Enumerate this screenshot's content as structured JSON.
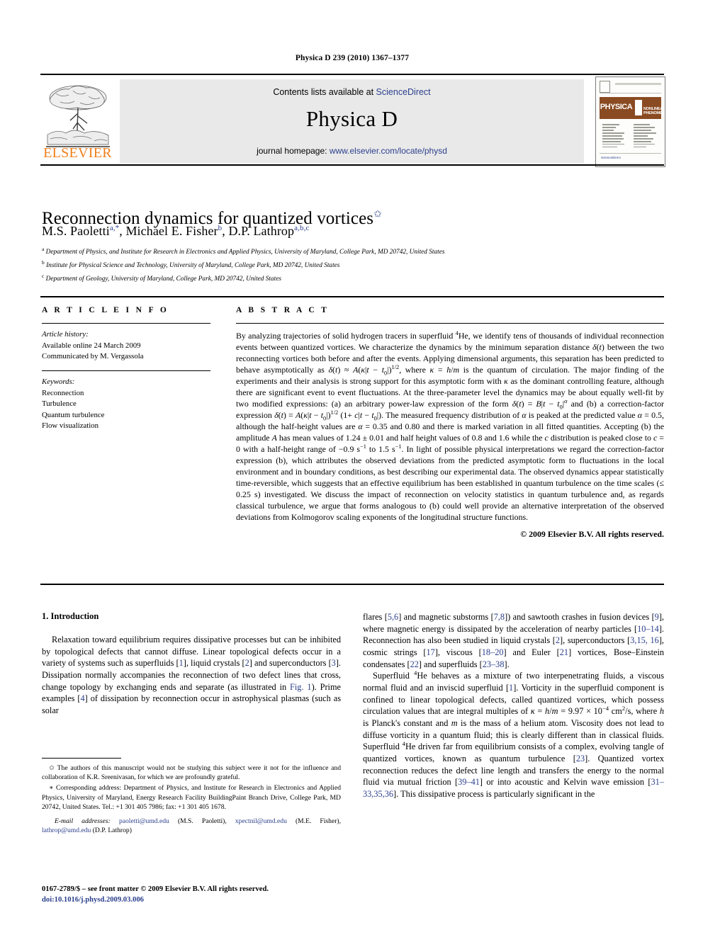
{
  "running_head": "Physica D 239 (2010) 1367–1377",
  "masthead": {
    "contents_prefix": "Contents lists available at ",
    "sciencedirect": "ScienceDirect",
    "journal_title": "Physica D",
    "homepage_prefix": "journal homepage: ",
    "homepage_url": "www.elsevier.com/locate/physd",
    "publisher": "ELSEVIER",
    "cover": {
      "physica": "PHYSICA",
      "volume_letter": "D",
      "subtitle": "NONLINEAR PHENOMENA",
      "sciencedirect": "ScienceDirect"
    },
    "accent_orange": "#F07F1A",
    "link_blue": "#2b3f8c",
    "banner_gray": "#e9e9e9",
    "cover_band_brown": "#8a4b22"
  },
  "article": {
    "title": "Reconnection dynamics for quantized vortices",
    "title_footnote_mark": "✩",
    "authors": "M.S. Paoletti, Michael E. Fisher, D.P. Lathrop",
    "author_list": [
      {
        "name": "M.S. Paoletti",
        "marks": "a,*"
      },
      {
        "name": "Michael E. Fisher",
        "marks": "b"
      },
      {
        "name": "D.P. Lathrop",
        "marks": "a,b,c"
      }
    ],
    "affiliations": [
      {
        "mark": "a",
        "text": "Department of Physics, and Institute for Research in Electronics and Applied Physics, University of Maryland, College Park, MD 20742, United States"
      },
      {
        "mark": "b",
        "text": "Institute for Physical Science and Technology, University of Maryland, College Park, MD 20742, United States"
      },
      {
        "mark": "c",
        "text": "Department of Geology, University of Maryland, College Park, MD 20742, United States"
      }
    ]
  },
  "info": {
    "heading": "A R T I C L E    I N F O",
    "history_label": "Article history:",
    "history_lines": [
      "Available online 24 March 2009",
      "Communicated by M. Vergassola"
    ],
    "keywords_label": "Keywords:",
    "keywords": [
      "Reconnection",
      "Turbulence",
      "Quantum turbulence",
      "Flow visualization"
    ]
  },
  "abstract": {
    "heading": "A B S T R A C T",
    "copyright": "© 2009 Elsevier B.V. All rights reserved."
  },
  "introduction": {
    "heading": "1. Introduction"
  },
  "footnotes": {
    "star_symbol": "✩",
    "corresponding_symbol": "∗",
    "email_label": "E-mail addresses:",
    "emails": [
      {
        "address": "paoletti@umd.edu",
        "owner": "(M.S. Paoletti)"
      },
      {
        "address": "xpectnil@umd.edu",
        "owner": "(M.E. Fisher)"
      },
      {
        "address": "lathrop@umd.edu",
        "owner": "(D.P. Lathrop)"
      }
    ]
  },
  "footer": {
    "issn_line": "0167-2789/$ – see front matter © 2009 Elsevier B.V. All rights reserved.",
    "doi": "doi:10.1016/j.physd.2009.03.006"
  }
}
